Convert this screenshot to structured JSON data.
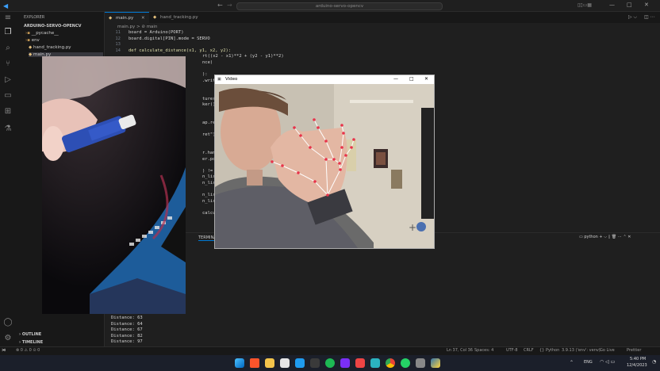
{
  "titlebar": {
    "search": "arduino-servo-opencv"
  },
  "sidebar": {
    "header": "EXPLORER",
    "project": "ARDUINO-SERVO-OPENCV",
    "items": [
      "__pycache__",
      "env",
      "hand_tracking.py",
      "main.py"
    ],
    "outline": "OUTLINE",
    "timeline": "TIMELINE"
  },
  "tabs": [
    {
      "label": "main.py"
    },
    {
      "label": "hand_tracking.py"
    }
  ],
  "breadcrumb": "main.py > ⊘ main",
  "code": [
    {
      "n": "11",
      "t": "board = Arduino(PORT)"
    },
    {
      "n": "12",
      "t": "board.digital[PIN].mode = SERVO"
    },
    {
      "n": "13",
      "t": ""
    },
    {
      "n": "14",
      "t": "def calculate_distance(x1, y1, x2, y2):"
    },
    {
      "n": "",
      "t": "rt((x2 - x1)**2 + (y2 - y1)**2)"
    },
    {
      "n": "",
      "t": "nce)"
    },
    {
      "n": "",
      "t": ""
    },
    {
      "n": "",
      "t": "):"
    },
    {
      "n": "",
      "t": ".write(val"
    },
    {
      "n": "",
      "t": ""
    },
    {
      "n": "",
      "t": ""
    },
    {
      "n": "",
      "t": "ture(0)"
    },
    {
      "n": "",
      "t": "ker()"
    },
    {
      "n": "",
      "t": ""
    },
    {
      "n": "",
      "t": ""
    },
    {
      "n": "",
      "t": "ap.read()"
    },
    {
      "n": "",
      "t": ""
    },
    {
      "n": "",
      "t": "ret\")"
    },
    {
      "n": "",
      "t": ""
    },
    {
      "n": "",
      "t": ""
    },
    {
      "n": "",
      "t": "r.handFind"
    },
    {
      "n": "",
      "t": "er.positio"
    },
    {
      "n": "",
      "t": ""
    },
    {
      "n": "",
      "t": ") != 0:"
    },
    {
      "n": "",
      "t": "n_list[8]"
    },
    {
      "n": "",
      "t": "n_list[8]"
    },
    {
      "n": "",
      "t": ""
    },
    {
      "n": "",
      "t": "n_list[4]"
    },
    {
      "n": "",
      "t": "n_list[4]"
    },
    {
      "n": "",
      "t": ""
    },
    {
      "n": "",
      "t": "calcula"
    }
  ],
  "panel": {
    "tab": "TERMINAL",
    "right": "python"
  },
  "terminal": [
    "Distance: 63",
    "Distance: 64",
    "Distance: 67",
    "Distance: 82",
    "Distance: 97"
  ],
  "statusbar": {
    "left": "⊗ 0 ⚠ 0  ⊙ 0",
    "items": [
      "Ln 37, Col 36",
      "Spaces: 4",
      "UTF-8",
      "CRLF",
      "{} Python",
      "3.9.13 ('env': venv)",
      "Go Live",
      "Prettier"
    ]
  },
  "video_window": {
    "title": "Video"
  },
  "tray": {
    "lang": "ENG",
    "time": "5:40 PM",
    "date": "12/4/2023"
  },
  "colors": {
    "accent": "#0078d4",
    "landmark": "#e8334a",
    "skeleton": "#ffffff"
  }
}
